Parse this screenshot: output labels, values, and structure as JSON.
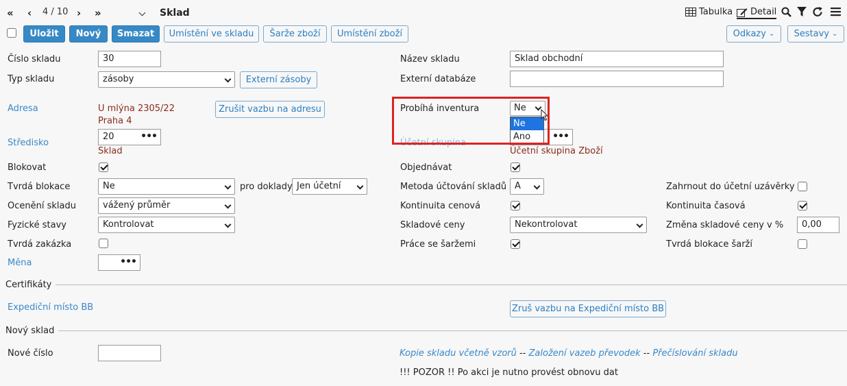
{
  "toolbar": {
    "pager": "4 / 10",
    "title": "Sklad",
    "view_table": "Tabulka",
    "view_detail": "Detail"
  },
  "actions": {
    "save": "Uložit",
    "new": "Nový",
    "delete": "Smazat",
    "placement": "Umístění ve skladu",
    "batches": "Šarže zboží",
    "goods_placement": "Umístění zboží",
    "links": "Odkazy",
    "reports": "Sestavy"
  },
  "form": {
    "warehouse_number_label": "Číslo skladu",
    "warehouse_number": "30",
    "warehouse_type_label": "Typ skladu",
    "warehouse_type": "zásoby",
    "external_stock_button": "Externí zásoby",
    "address_label": "Adresa",
    "address_line1": "U mlýna 2305/22",
    "address_line2": "Praha 4",
    "unlink_address_button": "Zrušit vazbu na adresu",
    "center_label": "Středisko",
    "center_value": "20",
    "center_name": "Sklad",
    "block_label": "Blokovat",
    "hard_block_label": "Tvrdá blokace",
    "hard_block": "Ne",
    "for_docs_label": "pro doklady",
    "for_docs": "Jen účetní",
    "valuation_label": "Ocenění skladu",
    "valuation": "vážený průměr",
    "physical_label": "Fyzické stavy",
    "physical": "Kontrolovat",
    "hard_order_label": "Tvrdá zakázka",
    "currency_label": "Měna",
    "name_label": "Název skladu",
    "name": "Sklad obchodní",
    "external_db_label": "Externí databáze",
    "external_db": "",
    "inventory_label": "Probíhá inventura",
    "inventory_value": "Ne",
    "inventory_options": [
      "Ne",
      "Ano"
    ],
    "accounting_group_label": "Účetní skupina",
    "accounting_group_name": "Účetní skupina Zboží",
    "order_label": "Objednávat",
    "method_label": "Metoda účtování skladů",
    "method": "A",
    "price_cont_label": "Kontinuita cenová",
    "stock_prices_label": "Skladové ceny",
    "stock_prices": "Nekontrolovat",
    "batches_label": "Práce se šaržemi",
    "include_closing_label": "Zahrnout do účetní uzávěrky",
    "time_cont_label": "Kontinuita časová",
    "price_change_label": "Změna skladové ceny v %",
    "price_change": "0,00",
    "hard_batch_label": "Tvrdá blokace šarží"
  },
  "certificates": {
    "section_title": "Certifikáty",
    "shipping_label": "Expediční místo BB",
    "unlink_shipping_button": "Zruš vazbu na Expediční místo BB"
  },
  "new_warehouse": {
    "section_title": "Nový sklad",
    "new_number_label": "Nové číslo",
    "copy_link": "Kopie skladu včetně vzorů",
    "sep1": " -- ",
    "links_link": "Založení vazeb převodek",
    "sep2": " -- ",
    "renumber_link": "Přečíslování skladu",
    "warning": "!!! POZOR !! Po akci je nutno provést obnovu dat"
  }
}
